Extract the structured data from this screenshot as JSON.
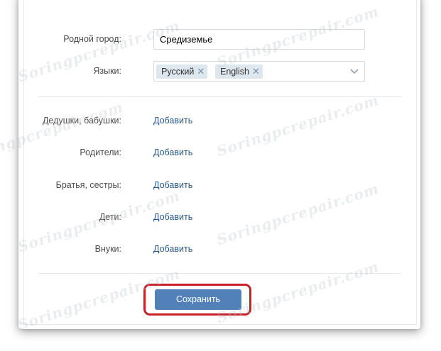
{
  "form": {
    "hometown": {
      "label": "Родной город:",
      "value": "Средиземье"
    },
    "languages": {
      "label": "Языки:",
      "tags": [
        "Русский",
        "English"
      ],
      "remove_glyph": "✕",
      "dropdown_icon": "chevron-down-icon"
    },
    "relatives": [
      {
        "key": "grandparents",
        "label": "Дедушки, бабушки:",
        "action": "Добавить"
      },
      {
        "key": "parents",
        "label": "Родители:",
        "action": "Добавить"
      },
      {
        "key": "siblings",
        "label": "Братья, сестры:",
        "action": "Добавить"
      },
      {
        "key": "children",
        "label": "Дети:",
        "action": "Добавить"
      },
      {
        "key": "grandchildren",
        "label": "Внуки:",
        "action": "Добавить"
      }
    ],
    "save_button": "Сохранить"
  },
  "watermark": "Soringpcrepair.com",
  "colors": {
    "button": "#5181b8",
    "link": "#2a5885",
    "highlight": "#c8202a",
    "tag_bg": "#dee6ee"
  }
}
